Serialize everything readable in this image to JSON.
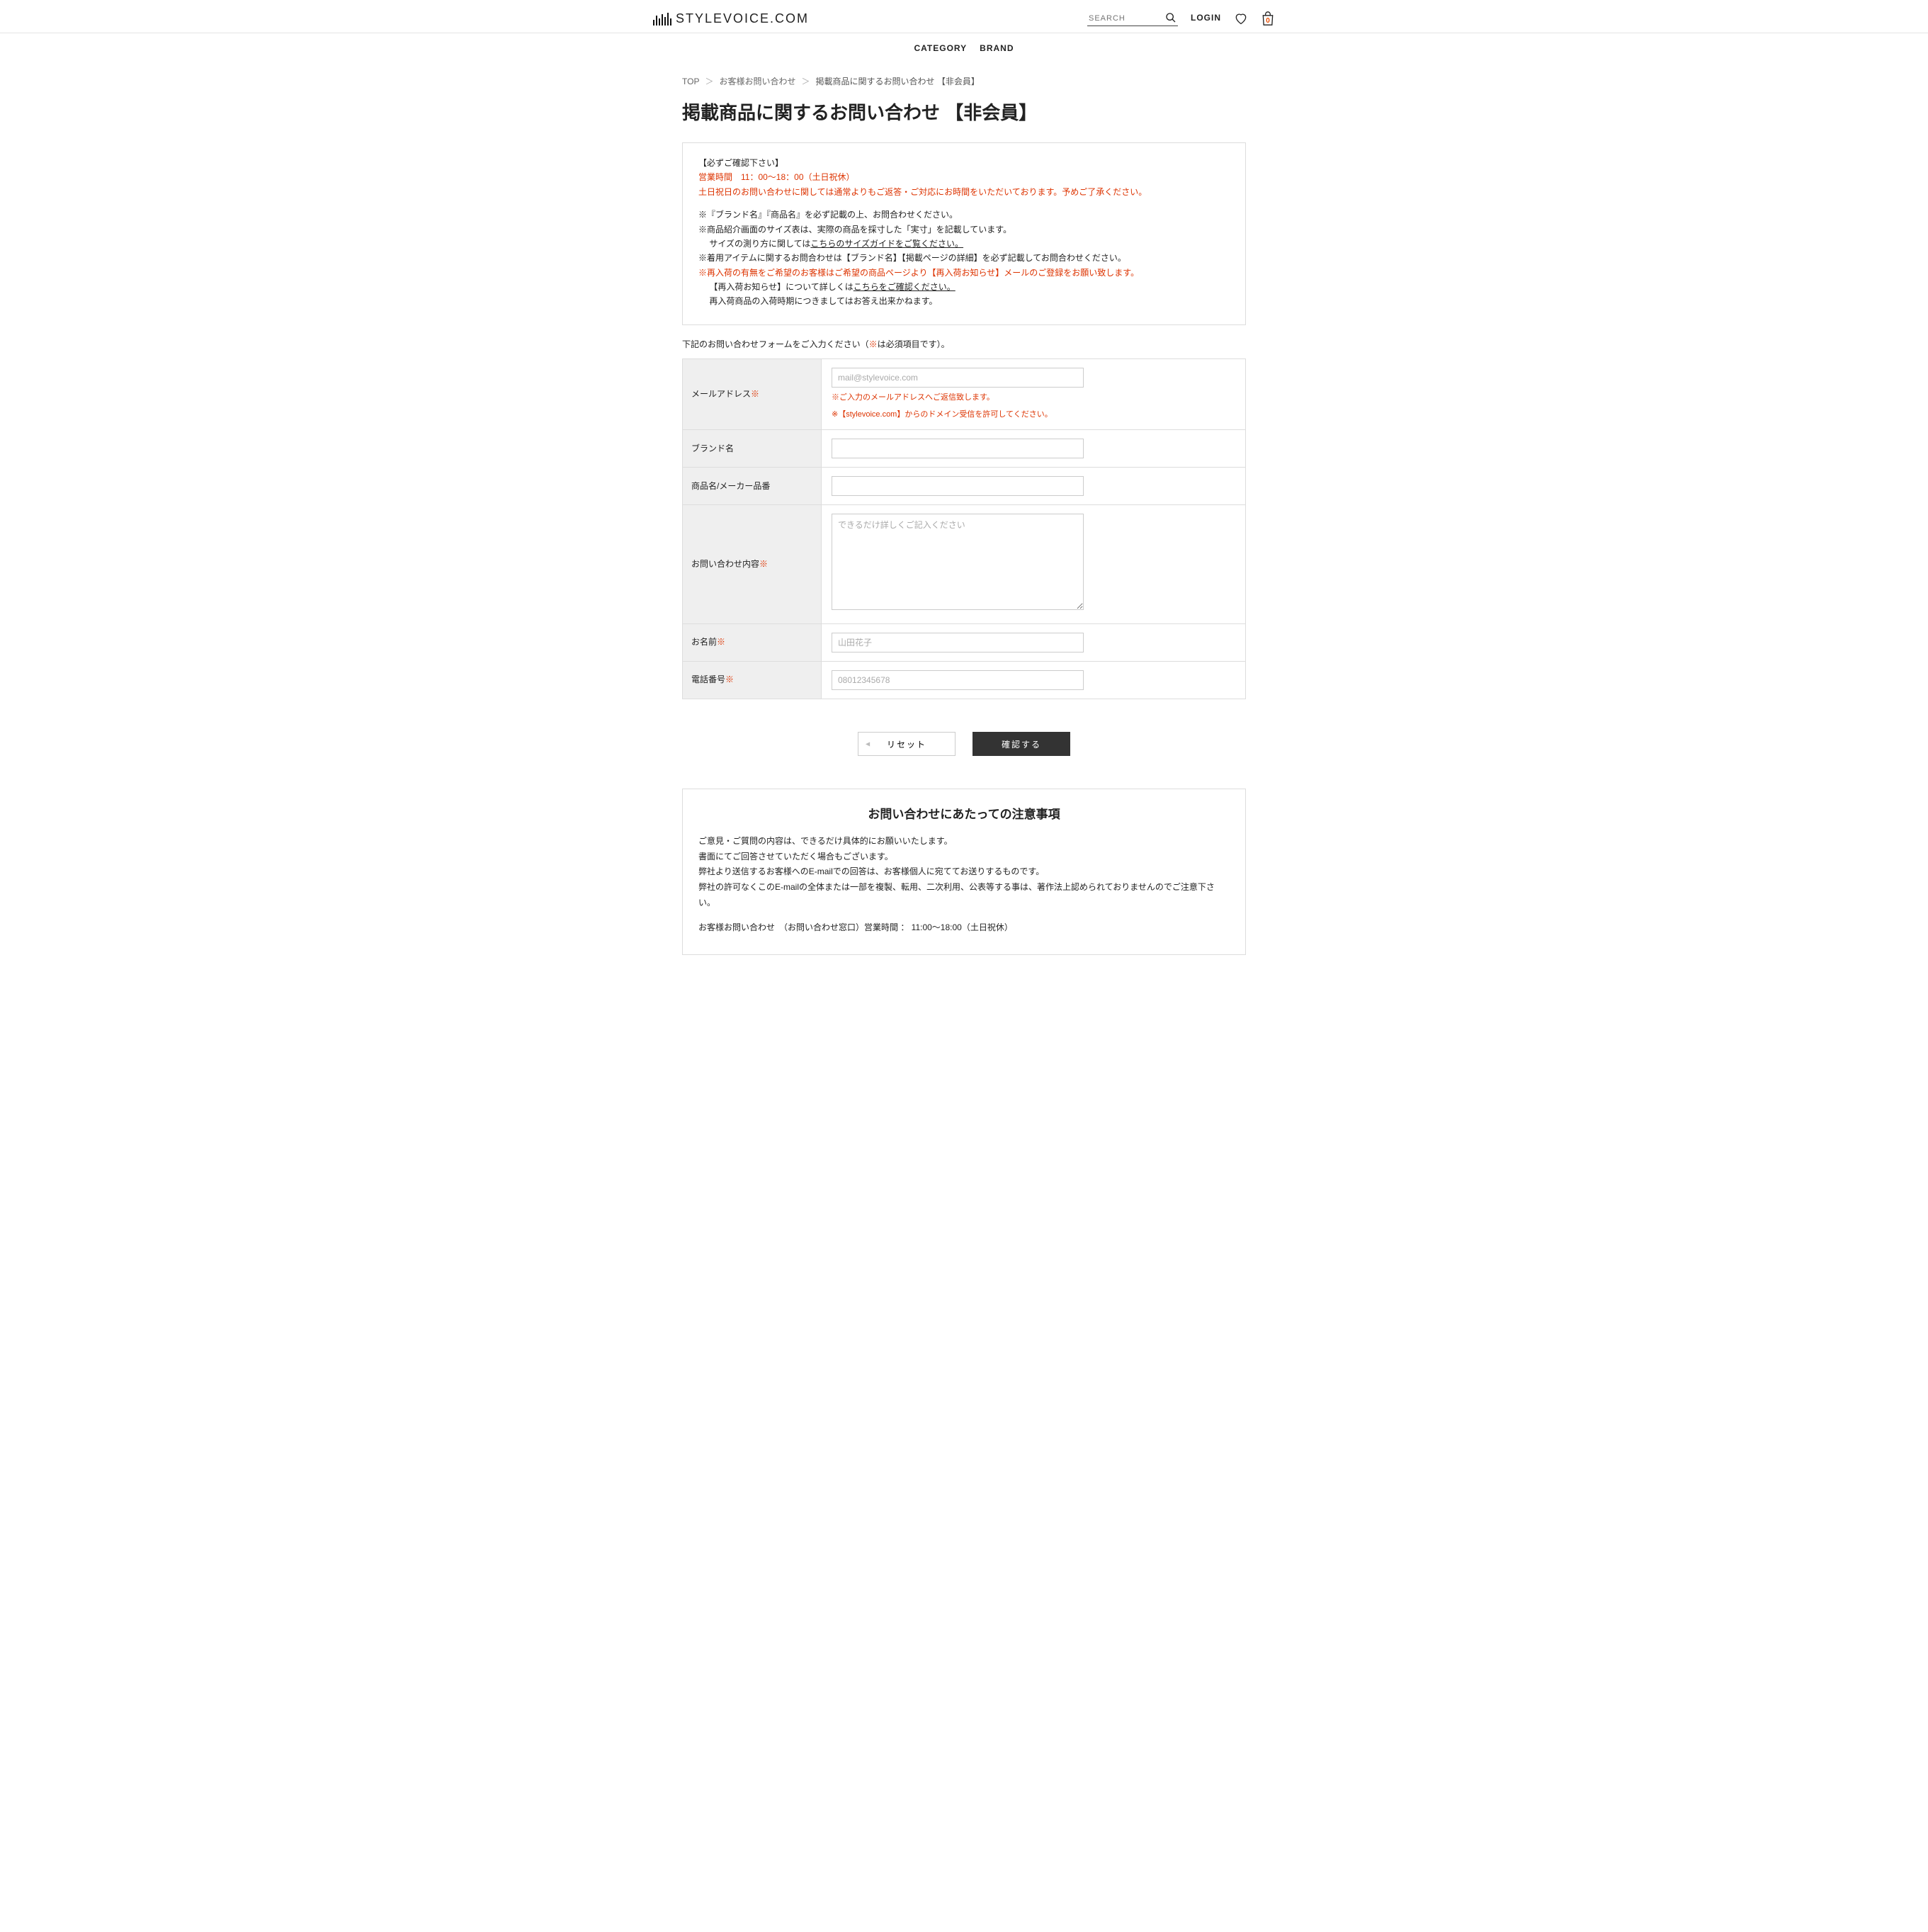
{
  "header": {
    "logo_text": "STYLEVOICE.COM",
    "search_placeholder": "SEARCH",
    "login_label": "LOGIN",
    "bag_count": "0"
  },
  "nav": {
    "category_label": "CATEGORY",
    "brand_label": "BRAND"
  },
  "breadcrumb": {
    "top": "TOP",
    "contact": "お客様お問い合わせ",
    "current": "掲載商品に関するお問い合わせ 【非会員】"
  },
  "page_title": "掲載商品に関するお問い合わせ 【非会員】",
  "notice": {
    "l1": "【必ずご確認下さい】",
    "l2": "営業時間　11：00～18：00（土日祝休）",
    "l3": "土日祝日のお問い合わせに関しては通常よりもご返答・ご対応にお時間をいただいております。予めご了承ください。",
    "l4": "※『ブランド名』『商品名』を必ず記載の上、お問合わせください。",
    "l5": "※商品紹介画面のサイズ表は、実際の商品を採寸した「実寸」を記載しています。",
    "l6_prefix": "　 サイズの測り方に関しては",
    "l6_link": "こちらのサイズガイドをご覧ください。",
    "l7": "※着用アイテムに関するお問合わせは【ブランド名】【掲載ページの詳細】を必ず記載してお問合わせください。",
    "l8": "※再入荷の有無をご希望のお客様はご希望の商品ページより【再入荷お知らせ】メールのご登録をお願い致します。",
    "l9_prefix": "　 【再入荷お知らせ】について詳しくは",
    "l9_link": "こちらをご確認ください。",
    "l10": "　 再入荷商品の入荷時期につきましてはお答え出来かねます。"
  },
  "form": {
    "lead_prefix": "下記のお問い合わせフォームをご入力ください（",
    "lead_mark": "※",
    "lead_suffix": "は必須項目です）。",
    "email_label": "メールアドレス",
    "email_placeholder": "mail@stylevoice.com",
    "email_note1": "※ご入力のメールアドレスへご返信致します。",
    "email_note2": "※【stylevoice.com】からのドメイン受信を許可してください。",
    "brand_label": "ブランド名",
    "product_label": "商品名/メーカー品番",
    "body_label": "お問い合わせ内容",
    "body_placeholder": "できるだけ詳しくご記入ください",
    "name_label": "お名前",
    "name_placeholder": "山田花子",
    "tel_label": "電話番号",
    "tel_placeholder": "08012345678",
    "reset_label": "リセット",
    "submit_label": "確認する"
  },
  "caution": {
    "title": "お問い合わせにあたっての注意事項",
    "l1": "ご意見・ご質問の内容は、できるだけ具体的にお願いいたします。",
    "l2": "書面にてご回答させていただく場合もございます。",
    "l3": "弊社より送信するお客様へのE-mailでの回答は、お客様個人に宛ててお送りするものです。",
    "l4": "弊社の許可なくこのE-mailの全体または一部を複製、転用、二次利用、公表等する事は、著作法上認められておりませんのでご注意下さい。",
    "l5": "お客様お問い合わせ　（お問い合わせ窓口）営業時間 ： 11:00～18:00（土日祝休）"
  }
}
